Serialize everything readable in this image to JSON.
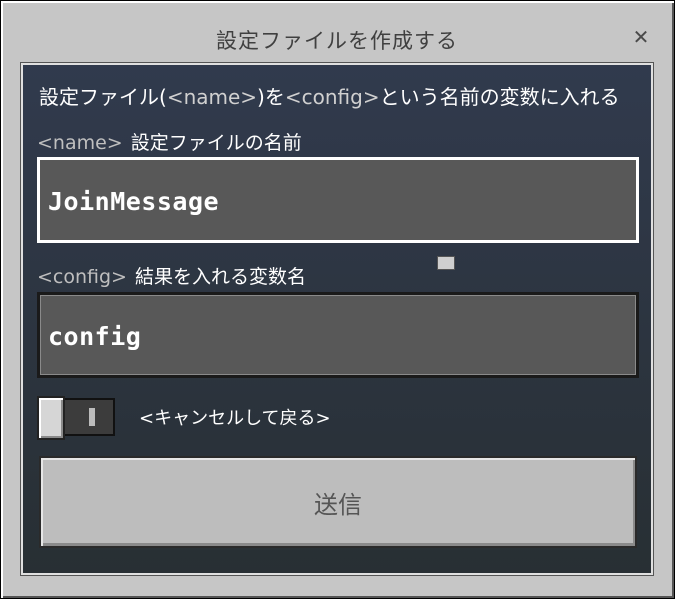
{
  "dialog": {
    "title": "設定ファイルを作成する",
    "close_icon": "close-icon",
    "description": {
      "prefix": "設定ファイル(",
      "tag1": "<name>",
      "mid": ")を",
      "tag2": "<config>",
      "suffix": "という名前の変数に入れる"
    },
    "fields": [
      {
        "tag": "<name>",
        "label": "設定ファイルの名前",
        "value": "JoinMessage",
        "focused": true
      },
      {
        "tag": "<config>",
        "label": "結果を入れる変数名",
        "value": "config",
        "focused": false
      }
    ],
    "toggle": {
      "label": "<キャンセルして戻る>",
      "state": "off"
    },
    "submit_label": "送信"
  },
  "colors": {
    "window_bg": "#c6c6c6",
    "panel_bg": "#1c2230",
    "field_bg": "#585858",
    "button_bg": "#bdbdbd"
  }
}
